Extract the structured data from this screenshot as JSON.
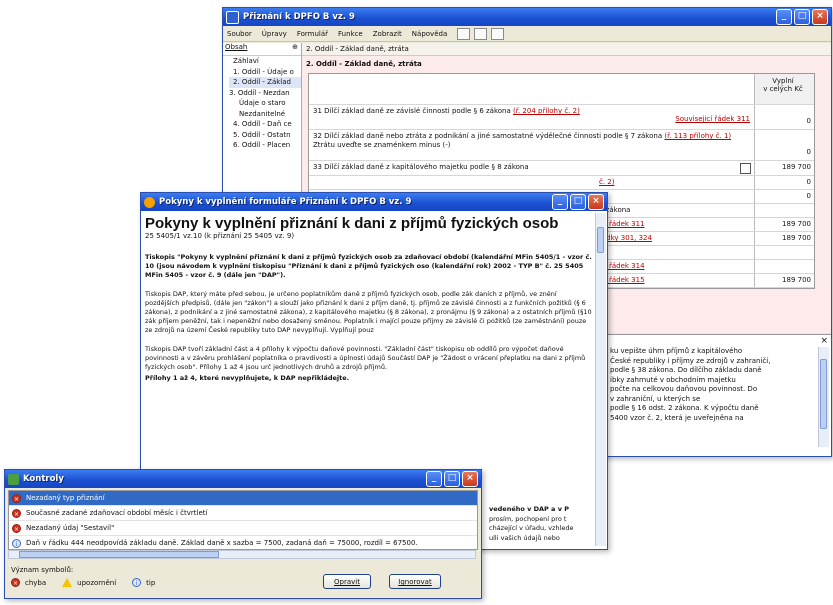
{
  "main_window": {
    "title": "Přiznání k DPFO B vz. 9",
    "menu": [
      "Soubor",
      "Úpravy",
      "Formulář",
      "Funkce",
      "Zobrazit",
      "Nápověda"
    ],
    "sidebar_header": "Obsah",
    "tree": [
      "Záhlaví",
      "1. Oddíl - Údaje o",
      "2. Oddíl - Základ",
      "3. Oddíl - Nezdan",
      "Údaje o staro",
      "Nezdanitelné",
      "4. Oddíl - Daň ce",
      "5. Oddíl - Ostatn",
      "6. Oddíl - Placen"
    ],
    "breadcrumb": "2. Oddíl - Základ daně, ztráta",
    "section_title": "2. Oddíl - Základ daně, ztráta",
    "column_header": "Vyplní\nv celých Kč",
    "rows": [
      {
        "text": "31  Dílčí základ daně ze závislé činnosti podle § 6 zákona",
        "link": "(ř. 204 přílohy č. 2)",
        "link2": "Souvisejicí řádek 311",
        "value": "0"
      },
      {
        "text": "32  Dílčí základ daně nebo ztráta z podnikání a jiné samostatné výdělečné činnosti podle § 7 zákona",
        "link": "(ř. 113 přílohy č. 1)",
        "extra": "Ztrátu uveďte se znaménkem minus (-)",
        "value": "0"
      },
      {
        "text": "33  Dílčí základ daně z kapitálového majetku podle § 8 zákona",
        "value": "189 700"
      }
    ],
    "partial_rows": [
      {
        "label": "č. 2)",
        "value": "0"
      },
      {
        "label": "2)",
        "value": "0"
      },
      {
        "label": "1 zákona",
        "value": ""
      },
      {
        "label": "ící řádek 311",
        "value": "189 700"
      },
      {
        "label": "řádky 301, 324",
        "value": "189 700"
      },
      {
        "label": "",
        "value": ""
      },
      {
        "label": "ící řádek 314",
        "value": ""
      },
      {
        "label": "ící řádek 315",
        "value": "189 700"
      }
    ],
    "help_lines": [
      "ku vepište úhrn příjmů z kapitálového",
      "České republiky i příjmy ze zdrojů v zahraničí,",
      "podle § 38 zákona. Do dílčího základu daně",
      "ibky zahrnuté v obchodním majetku",
      "počte na celkovou daňovou povinnost. Do",
      "v zahraniční, u kterých se",
      "podle § 16 odst. 2 zákona. K výpočtu daně",
      "5400 vzor č. 2, která je uveřejněna na"
    ]
  },
  "doc_window": {
    "title": "Pokyny k vyplnění formuláře Přiznání k DPFO B vz. 9",
    "heading": "Pokyny k vyplnění přiznání k dani z příjmů fyzických osob",
    "subheading": "25 5405/1 vz.10 (k přiznání 25 5405 vz. 9)",
    "para1": "Tiskopis \"Pokyny k vyplnění přiznání k dani z příjmů fyzických osob za zdaňovací období (kalendářní MFin 5405/1 - vzor č. 10 (jsou návodem k vyplnění tiskopisu \"Přiznání k dani z příjmů fyzických oso (kalendářní rok) 2002 - TYP B\" č. 25 5405 MFin 5405 - vzor č. 9 (dále jen \"DAP\").",
    "para2": "Tiskopis DAP, který máte před sebou, je určeno poplatníkům daně z příjmů fyzických osob, podle zák daních z příjmů, ve znění pozdějších předpisů, (dále jen \"zákon\") a slouží jako přiznání k dani z příjm daně, tj. příjmů ze závislé činnosti a z funkčních požitků (§ 6 zákona), z podnikání a z jiné samostatné zákona), z kapitálového majetku (§ 8 zákona), z pronájmu (§ 9 zákona) a z ostatních příjmů (§10 zák příjem peněžní, tak i nepeněžní nebo dosažený směnou. Poplatník i mající pouze příjmy ze závislé či požitků (ze zaměstnání) pouze ze zdrojů na území České republiky tuto DAP nevyplňují. Vyplňují pouz",
    "para3": "Tiskopis DAP tvoří základní část a 4 přílohy k výpočtu daňové povinnosti. \"Základní část\" tiskopisu ob oddílů pro výpočet daňové povinnosti a v závěru prohlášení poplatníka o pravdivosti a úplnosti údajů Součástí DAP je \"Žádost o vrácení přeplatku na dani z příjmů fyzických osob\". Přílohy 1 až 4 jsou urč jednotlivých druhů a zdrojů příjmů.",
    "para4": "Přílohy 1 až 4, které nevyplňujete, k DAP nepřikládejte.",
    "tail_lines": [
      "vedeného v DAP a v P",
      "prosím, pochopení pro t",
      "cházející v úřadu, vzhlede",
      "ulli vašich údajů nebo"
    ]
  },
  "ctrl_window": {
    "title": "Kontroly",
    "items": [
      {
        "kind": "error",
        "text": "Nezadaný typ přiznání",
        "selected": true
      },
      {
        "kind": "error",
        "text": "Současné zadané zdaňovací období měsíc i čtvrtletí",
        "selected": false
      },
      {
        "kind": "error",
        "text": "Nezadaný údaj \"Sestavil\"",
        "selected": false
      },
      {
        "kind": "info",
        "text": "Daň v řádku 444 neodpovídá základu daně. Základ daně x sazba = 7500, zadaná daň = 75000, rozdíl = 67500.",
        "selected": false
      }
    ],
    "legend_title": "Význam symbolů:",
    "legend": [
      {
        "kind": "error",
        "label": "chyba"
      },
      {
        "kind": "warning",
        "label": "upozornění"
      },
      {
        "kind": "info",
        "label": "tip"
      }
    ],
    "btn_go": "Opravit",
    "btn_ignore": "Ignorovat"
  },
  "colors": {
    "title_blue": "#1a4fd0",
    "panel_pink": "#fdeaea",
    "link_red": "#b00000",
    "error_red": "#d03020",
    "warn_yellow": "#f5c400",
    "info_blue": "#3b68d0"
  }
}
